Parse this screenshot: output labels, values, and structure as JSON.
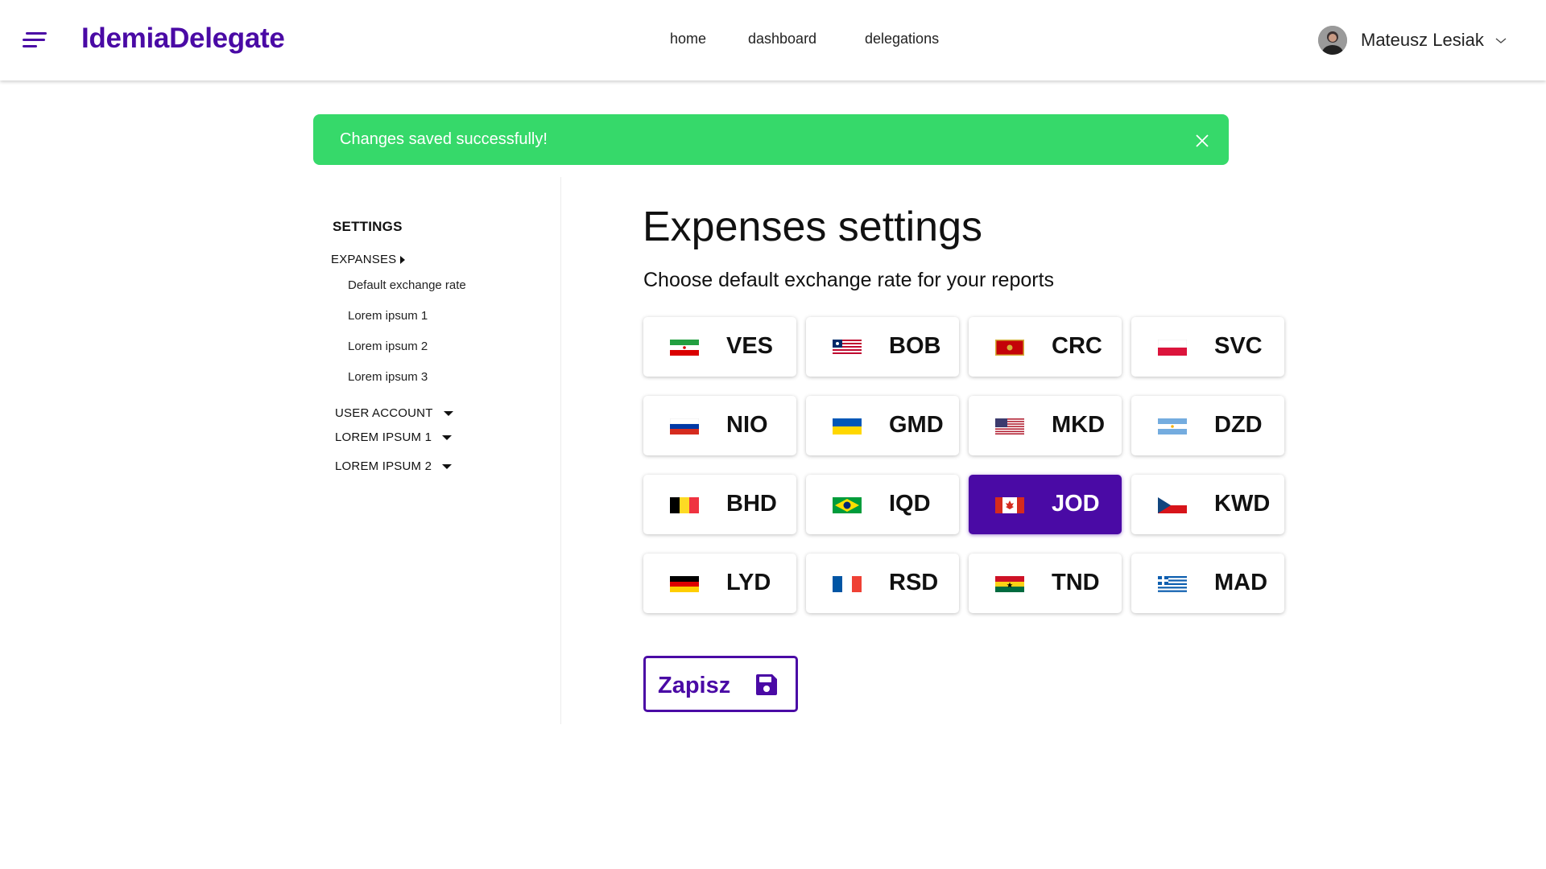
{
  "header": {
    "brand": "IdemiaDelegate",
    "nav": [
      "home",
      "dashboard",
      "delegations"
    ],
    "user_name": "Mateusz Lesiak"
  },
  "alert": {
    "message": "Changes saved successfully!",
    "color": "#36d96a"
  },
  "sidebar": {
    "title": "SETTINGS",
    "expanses": {
      "label": "EXPANSES",
      "items": [
        "Default exchange rate",
        "Lorem ipsum 1",
        "Lorem ipsum 2",
        "Lorem ipsum 3"
      ]
    },
    "sections": [
      "USER ACCOUNT",
      "LOREM IPSUM 1",
      "LOREM IPSUM 2"
    ]
  },
  "main": {
    "title": "Expenses settings",
    "subtitle": "Choose default exchange rate for your reports",
    "currencies": [
      {
        "code": "VES",
        "flag": "iran-flag-icon",
        "selected": false
      },
      {
        "code": "BOB",
        "flag": "liberia-flag-icon",
        "selected": false
      },
      {
        "code": "CRC",
        "flag": "montenegro-flag-icon",
        "selected": false
      },
      {
        "code": "SVC",
        "flag": "poland-flag-icon",
        "selected": false
      },
      {
        "code": "NIO",
        "flag": "russia-flag-icon",
        "selected": false
      },
      {
        "code": "GMD",
        "flag": "ukraine-flag-icon",
        "selected": false
      },
      {
        "code": "MKD",
        "flag": "usa-flag-icon",
        "selected": false
      },
      {
        "code": "DZD",
        "flag": "argentina-flag-icon",
        "selected": false
      },
      {
        "code": "BHD",
        "flag": "belgium-flag-icon",
        "selected": false
      },
      {
        "code": "IQD",
        "flag": "brazil-flag-icon",
        "selected": false
      },
      {
        "code": "JOD",
        "flag": "canada-flag-icon",
        "selected": true
      },
      {
        "code": "KWD",
        "flag": "czech-flag-icon",
        "selected": false
      },
      {
        "code": "LYD",
        "flag": "germany-flag-icon",
        "selected": false
      },
      {
        "code": "RSD",
        "flag": "france-flag-icon",
        "selected": false
      },
      {
        "code": "TND",
        "flag": "ghana-flag-icon",
        "selected": false
      },
      {
        "code": "MAD",
        "flag": "greece-flag-icon",
        "selected": false
      }
    ],
    "save_label": "Zapisz"
  },
  "colors": {
    "brand": "#4a0aa5",
    "success": "#36d96a",
    "selected_tile": "#4a0aa5"
  }
}
